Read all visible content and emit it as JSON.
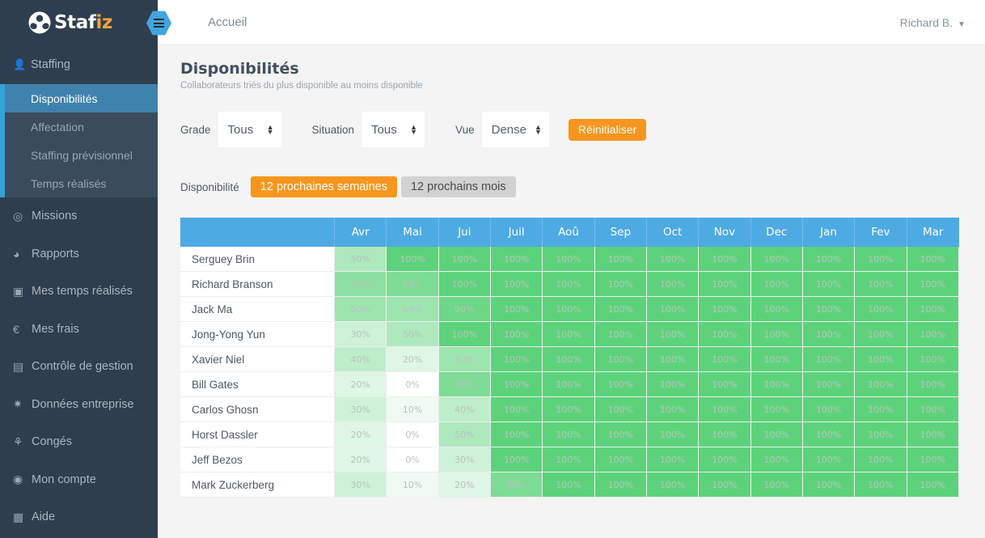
{
  "brand": {
    "name_main": "Staf",
    "name_accent": "iz",
    "accent_color": "#f2a03d"
  },
  "topbar": {
    "menu_icon": "hamburger-icon",
    "breadcrumb": "Accueil",
    "user": "Richard B.",
    "caret": "▼"
  },
  "sidebar": {
    "section": {
      "label": "Staffing",
      "icon": "user-icon"
    },
    "subitems": [
      {
        "label": "Disponibilités",
        "active": true
      },
      {
        "label": "Affectation",
        "active": false
      },
      {
        "label": "Staffing prévisionnel",
        "active": false
      },
      {
        "label": "Temps réalisés",
        "active": false
      }
    ],
    "items": [
      {
        "label": "Missions",
        "icon": "target-icon",
        "glyph": "◎"
      },
      {
        "label": "Rapports",
        "icon": "pie-chart-icon",
        "glyph": "◕"
      },
      {
        "label": "Mes temps réalisés",
        "icon": "calendar-check-icon",
        "glyph": "▣"
      },
      {
        "label": "Mes frais",
        "icon": "euro-coin-icon",
        "glyph": "€"
      },
      {
        "label": "Contrôle de gestion",
        "icon": "document-icon",
        "glyph": "▤"
      },
      {
        "label": "Données entreprise",
        "icon": "gear-icon",
        "glyph": "✷"
      },
      {
        "label": "Congés",
        "icon": "palm-tree-icon",
        "glyph": "⚘"
      },
      {
        "label": "Mon compte",
        "icon": "account-circle-icon",
        "glyph": "◉"
      },
      {
        "label": "Aide",
        "icon": "calendar-icon",
        "glyph": "▦"
      }
    ]
  },
  "page": {
    "title": "Disponibilités",
    "subtitle": "Collaborateurs triés du plus disponible au moins disponible"
  },
  "filters": {
    "grade_label": "Grade",
    "grade_value": "Tous",
    "situation_label": "Situation",
    "situation_value": "Tous",
    "vue_label": "Vue",
    "vue_value": "Dense",
    "reset_label": "Réinitialiser",
    "reset_color": "#f7961e"
  },
  "period": {
    "label": "Disponibilité",
    "options": [
      {
        "label": "12 prochaines semaines",
        "selected": true
      },
      {
        "label": "12 prochains mois",
        "selected": false
      }
    ]
  },
  "chart_data": {
    "type": "heatmap",
    "title": "Disponibilités",
    "xlabel": "",
    "ylabel": "",
    "header_color": "#4eaae3",
    "scale": {
      "min": 0,
      "max": 100,
      "unit": "%",
      "low_color": "#ffffff",
      "high_color": "#5cd37a"
    },
    "name_header": "",
    "categories": [
      "Avr",
      "Mai",
      "Jui",
      "Juil",
      "Aoû",
      "Sep",
      "Oct",
      "Nov",
      "Dec",
      "Jan",
      "Fev",
      "Mar"
    ],
    "series": [
      {
        "name": "Serguey Brin",
        "values": [
          50,
          100,
          100,
          100,
          100,
          100,
          100,
          100,
          100,
          100,
          100,
          100
        ]
      },
      {
        "name": "Richard Branson",
        "values": [
          70,
          80,
          100,
          100,
          100,
          100,
          100,
          100,
          100,
          100,
          100,
          100
        ]
      },
      {
        "name": "Jack Ma",
        "values": [
          60,
          60,
          90,
          100,
          100,
          100,
          100,
          100,
          100,
          100,
          100,
          100
        ]
      },
      {
        "name": "Jong-Yong Yun",
        "values": [
          30,
          50,
          100,
          100,
          100,
          100,
          100,
          100,
          100,
          100,
          100,
          100
        ]
      },
      {
        "name": "Xavier Niel",
        "values": [
          40,
          20,
          60,
          100,
          100,
          100,
          100,
          100,
          100,
          100,
          100,
          100
        ]
      },
      {
        "name": "Bill Gates",
        "values": [
          20,
          0,
          80,
          100,
          100,
          100,
          100,
          100,
          100,
          100,
          100,
          100
        ]
      },
      {
        "name": "Carlos Ghosn",
        "values": [
          30,
          10,
          40,
          100,
          100,
          100,
          100,
          100,
          100,
          100,
          100,
          100
        ]
      },
      {
        "name": "Horst Dassler",
        "values": [
          20,
          0,
          50,
          100,
          100,
          100,
          100,
          100,
          100,
          100,
          100,
          100
        ]
      },
      {
        "name": "Jeff Bezos",
        "values": [
          20,
          0,
          30,
          100,
          100,
          100,
          100,
          100,
          100,
          100,
          100,
          100
        ]
      },
      {
        "name": "Mark Zuckerberg",
        "values": [
          30,
          10,
          20,
          80,
          100,
          100,
          100,
          100,
          100,
          100,
          100,
          100
        ]
      }
    ]
  }
}
